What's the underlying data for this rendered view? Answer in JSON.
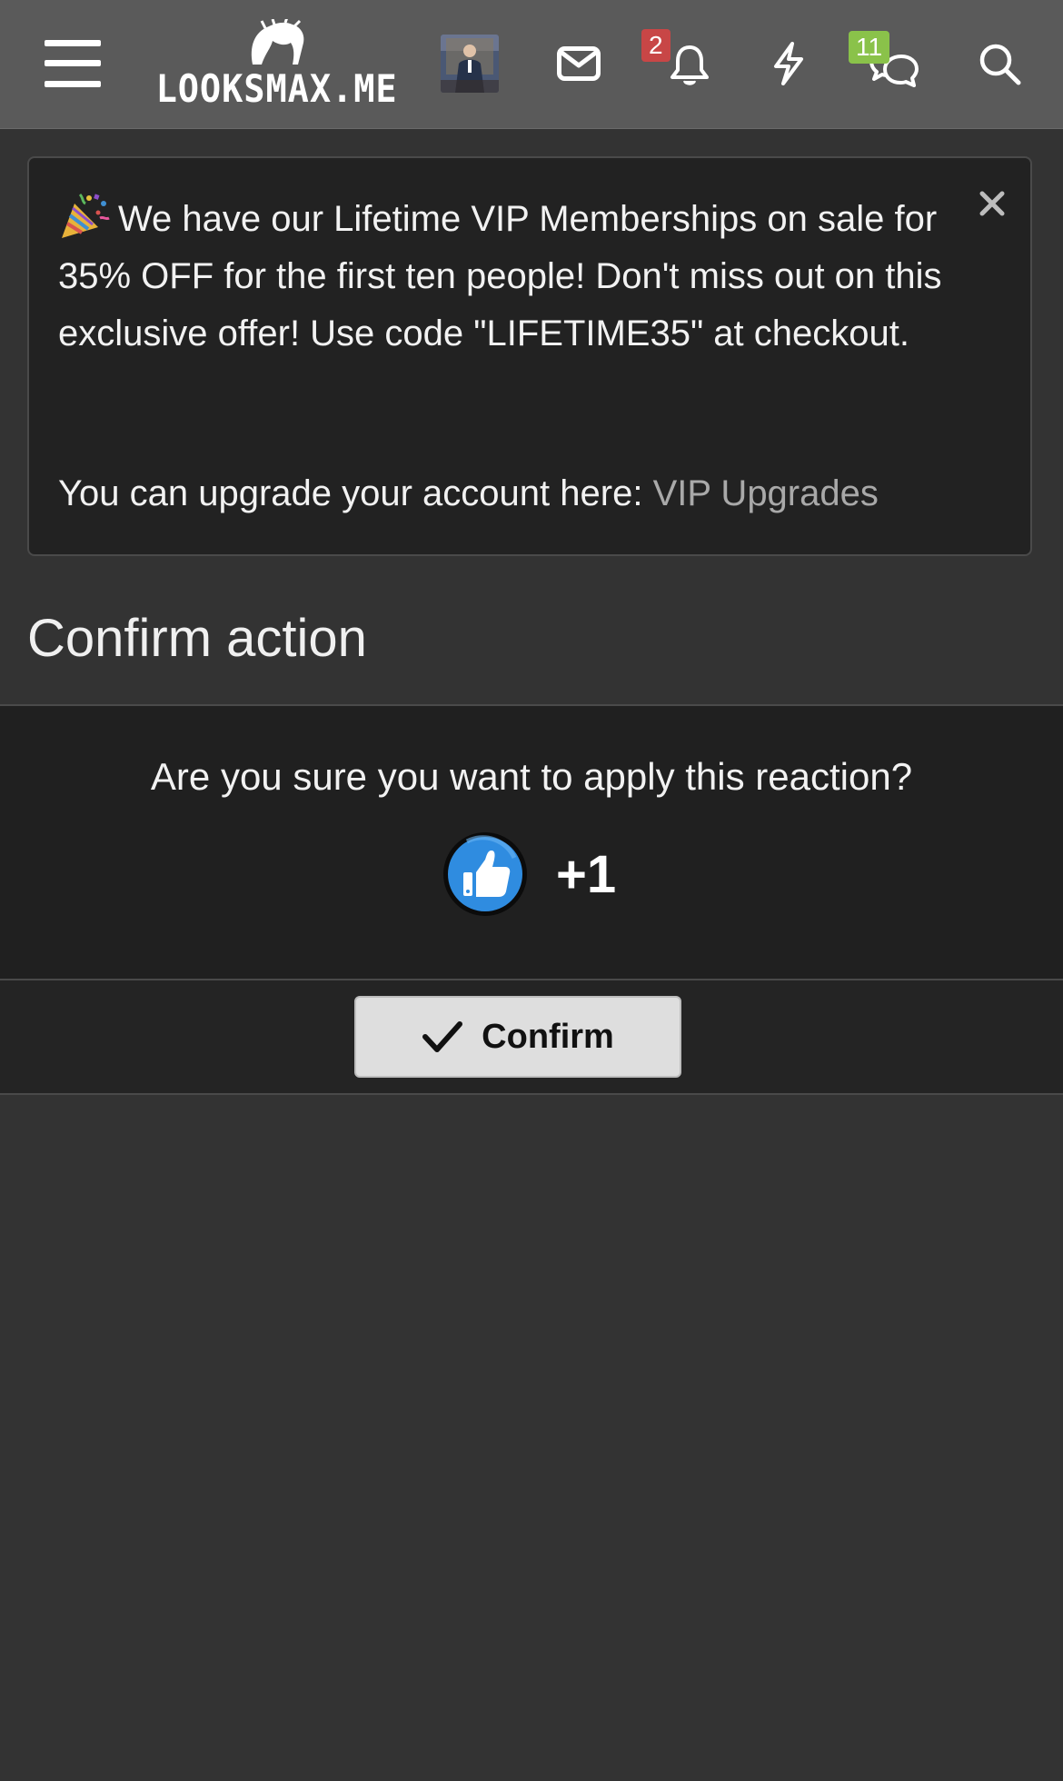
{
  "header": {
    "logo_text": "LOOKSMAX.ME",
    "alerts_badge": "2",
    "conversations_badge": "11",
    "icons": [
      "menu-icon",
      "hair-logo-icon",
      "avatar",
      "mail-icon",
      "bell-icon",
      "bolt-icon",
      "chat-icon",
      "search-icon"
    ]
  },
  "notice": {
    "message": "We have our Lifetime VIP Memberships on sale for 35% OFF for the first ten people! Don't miss out on this exclusive offer! Use code \"LIFETIME35\" at checkout.",
    "upgrade_prefix": "You can upgrade your account here: ",
    "upgrade_link": "VIP Upgrades",
    "emoji": "party-popper-icon"
  },
  "page": {
    "title": "Confirm action"
  },
  "confirm": {
    "question": "Are you sure you want to apply this reaction?",
    "reaction_label": "+1",
    "reaction_icon": "thumbs-up-icon",
    "button_label": "Confirm"
  },
  "colors": {
    "header_bg": "#5a5a5a",
    "page_bg": "#333333",
    "notice_bg": "#222222",
    "alert_badge": "#c84646",
    "conversation_badge": "#8ac24a",
    "reaction_blue": "#2f8ce0",
    "button_bg": "#dedede"
  }
}
